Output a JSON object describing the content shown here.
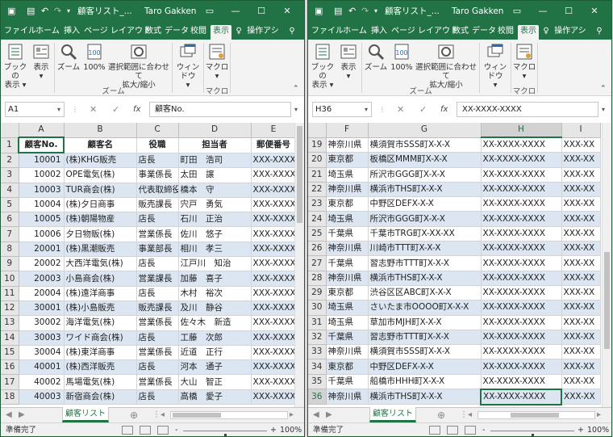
{
  "titlebar": {
    "title": "顧客リスト_...",
    "user": "Taro Gakken",
    "save_icon": "save-icon",
    "undo_icon": "undo-icon",
    "redo_icon": "redo-icon",
    "ribbon_display_icon": "ribbon-display-icon",
    "minimize": "—",
    "restore": "☐",
    "close": "✕"
  },
  "tabs": [
    "ファイル",
    "ホーム",
    "挿入",
    "ページ レイアウト",
    "数式",
    "データ",
    "校閲",
    "表示",
    "操作アシ"
  ],
  "tell_me_icon": "lightbulb-icon",
  "account_icon": "person-icon",
  "ribbon": {
    "book_view": [
      "ブックの",
      "表示 ▾"
    ],
    "show": [
      "表示",
      "▾"
    ],
    "zoom": "ズーム",
    "zoom100": "100%",
    "zoom_selection": [
      "選択範囲に合わせて",
      "拡大/縮小"
    ],
    "window": [
      "ウィンドウ",
      "▾"
    ],
    "macro": [
      "マクロ",
      "▾"
    ],
    "group_zoom": "ズーム",
    "group_macro": "マクロ"
  },
  "left": {
    "namebox": "A1",
    "formula": "顧客No.",
    "columns": [
      "A",
      "B",
      "C",
      "D",
      "E"
    ],
    "header_row": [
      "顧客No.",
      "顧客名",
      "役職",
      "担当者",
      "郵便番号"
    ],
    "rows": [
      {
        "n": "1",
        "header": true
      },
      {
        "n": "2",
        "cells": [
          "10001",
          "(株)KHG販売",
          "店長",
          "町田　浩司",
          "XXX-XXXX"
        ]
      },
      {
        "n": "3",
        "cells": [
          "10002",
          "OPE電気(株)",
          "事業係長",
          "太田　譲",
          "XXX-XXXX"
        ]
      },
      {
        "n": "4",
        "cells": [
          "10003",
          "TUR商会(株)",
          "代表取締役",
          "橋本　守",
          "XXX-XXXX"
        ]
      },
      {
        "n": "5",
        "cells": [
          "10004",
          "(株)夕日商事",
          "販売課長",
          "宍戸　勇気",
          "XXX-XXXX"
        ]
      },
      {
        "n": "6",
        "cells": [
          "10005",
          "(株)朝陽物産",
          "店長",
          "石川　正治",
          "XXX-XXXX"
        ]
      },
      {
        "n": "7",
        "cells": [
          "10006",
          "夕日物販(株)",
          "営業係長",
          "佐川　悠子",
          "XXX-XXXX"
        ]
      },
      {
        "n": "8",
        "cells": [
          "20001",
          "(株)黒潮販売",
          "事業部長",
          "相川　孝三",
          "XXX-XXXX"
        ]
      },
      {
        "n": "9",
        "cells": [
          "20002",
          "大西洋電気(株)",
          "店長",
          "江戸川　知治",
          "XXX-XXXX"
        ]
      },
      {
        "n": "10",
        "cells": [
          "20003",
          "小島商会(株)",
          "営業課長",
          "加藤　喜子",
          "XXX-XXXX"
        ]
      },
      {
        "n": "11",
        "cells": [
          "20004",
          "(株)遠洋商事",
          "店長",
          "木村　裕次",
          "XXX-XXXX"
        ]
      },
      {
        "n": "12",
        "cells": [
          "30001",
          "(株)小島販売",
          "販売課長",
          "及川　静谷",
          "XXX-XXXX"
        ]
      },
      {
        "n": "13",
        "cells": [
          "30002",
          "海洋電気(株)",
          "営業係長",
          "佐々木　新造",
          "XXX-XXXX"
        ]
      },
      {
        "n": "14",
        "cells": [
          "30003",
          "ワイド商会(株)",
          "店長",
          "工藤　次郎",
          "XXX-XXXX"
        ]
      },
      {
        "n": "15",
        "cells": [
          "30004",
          "(株)東洋商事",
          "営業係長",
          "近道　正行",
          "XXX-XXXX"
        ]
      },
      {
        "n": "16",
        "cells": [
          "40001",
          "(株)西洋販売",
          "店長",
          "河本　通子",
          "XXX-XXXX"
        ]
      },
      {
        "n": "17",
        "cells": [
          "40002",
          "馬場電気(株)",
          "営業係長",
          "大山　智正",
          "XXX-XXXX"
        ]
      },
      {
        "n": "18",
        "cells": [
          "40003",
          "新宿商会(株)",
          "店長",
          "高橋　愛子",
          "XXX-XXXX"
        ]
      }
    ]
  },
  "right": {
    "namebox": "H36",
    "formula": "XX-XXXX-XXXX",
    "columns": [
      "F",
      "G",
      "H",
      "I"
    ],
    "rows": [
      {
        "n": "19",
        "cells": [
          "神奈川県",
          "横須賀市SSS町X-X-X",
          "XX-XXXX-XXXX",
          "XXX-XX"
        ]
      },
      {
        "n": "20",
        "cells": [
          "東京都",
          "板橋区MMM町X-X-X",
          "XX-XXXX-XXXX",
          "XXX-XX"
        ]
      },
      {
        "n": "21",
        "cells": [
          "埼玉県",
          "所沢市GGG町X-X-X",
          "XX-XXXX-XXXX",
          "XXX-XX"
        ]
      },
      {
        "n": "22",
        "cells": [
          "神奈川県",
          "横浜市THS町X-X-X",
          "XX-XXXX-XXXX",
          "XXX-XX"
        ]
      },
      {
        "n": "23",
        "cells": [
          "東京都",
          "中野区DEFX-X-X",
          "XX-XXXX-XXXX",
          "XXX-XX"
        ]
      },
      {
        "n": "24",
        "cells": [
          "埼玉県",
          "所沢市GGG町X-X-X",
          "XX-XXXX-XXXX",
          "XXX-XX"
        ]
      },
      {
        "n": "25",
        "cells": [
          "千葉県",
          "千葉市TRG町X-XX-XX",
          "XX-XXXX-XXXX",
          "XXX-XX"
        ]
      },
      {
        "n": "26",
        "cells": [
          "神奈川県",
          "川崎市TTT町X-X-X",
          "XX-XXXX-XXXX",
          "XXX-XX"
        ]
      },
      {
        "n": "27",
        "cells": [
          "千葉県",
          "習志野市TTT町X-X-X",
          "XX-XXXX-XXXX",
          "XXX-XX"
        ]
      },
      {
        "n": "28",
        "cells": [
          "神奈川県",
          "横浜市THS町X-X-X",
          "XX-XXXX-XXXX",
          "XXX-XX"
        ]
      },
      {
        "n": "29",
        "cells": [
          "東京都",
          "渋谷区区ABC町X-X-X",
          "XX-XXXX-XXXX",
          "XXX-XX"
        ]
      },
      {
        "n": "30",
        "cells": [
          "埼玉県",
          "さいたま市OOOO町X-X-X",
          "XX-XXXX-XXXX",
          "XXX-XX"
        ]
      },
      {
        "n": "31",
        "cells": [
          "埼玉県",
          "草加市MJH町X-X-X",
          "XX-XXXX-XXXX",
          "XXX-XX"
        ]
      },
      {
        "n": "32",
        "cells": [
          "千葉県",
          "習志野市TTT町X-X-X",
          "XX-XXXX-XXXX",
          "XXX-XX"
        ]
      },
      {
        "n": "33",
        "cells": [
          "神奈川県",
          "横須賀市SSS町X-X-X",
          "XX-XXXX-XXXX",
          "XXX-XX"
        ]
      },
      {
        "n": "34",
        "cells": [
          "東京都",
          "中野区DEFX-X-X",
          "XX-XXXX-XXXX",
          "XXX-XX"
        ]
      },
      {
        "n": "35",
        "cells": [
          "千葉県",
          "船橋市HHH町X-X-X",
          "XX-XXXX-XXXX",
          "XXX-XX"
        ]
      },
      {
        "n": "36",
        "cells": [
          "神奈川県",
          "横浜市THS町X-X-X",
          "XX-XXXX-XXXX",
          "XXX-XX"
        ]
      }
    ]
  },
  "sheet_tab": "顧客リスト",
  "add_sheet": "⊕",
  "status": {
    "ready": "準備完了",
    "zoom": "100%",
    "zoom_minus": "-",
    "zoom_plus": "+"
  },
  "colors": {
    "accent": "#217346",
    "band": "#dce6f2"
  }
}
